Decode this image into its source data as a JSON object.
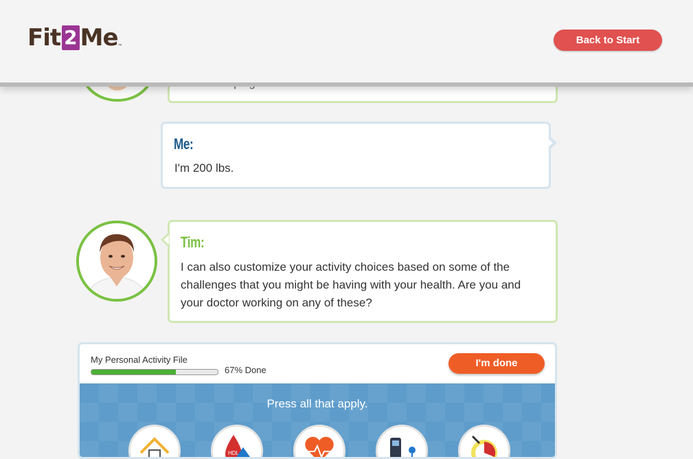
{
  "header": {
    "logo": {
      "part1": "Fit",
      "part2": "2",
      "part3": "Me",
      "trademark": "™"
    },
    "back_button": "Back to Start"
  },
  "conversation": {
    "previous_fragment": "...p...g...",
    "me": {
      "name": "Me:",
      "text": "I'm 200 lbs."
    },
    "tim": {
      "name": "Tim:",
      "text": "I can also customize your activity choices based on some of the challenges that you might be having with your health. Are you and your doctor working on any of these?"
    }
  },
  "activity_panel": {
    "title": "My Personal Activity File",
    "progress_percent": 67,
    "progress_text": "67% Done",
    "done_button": "I'm done",
    "prompt": "Press all that apply.",
    "choice_icons": [
      "house-icon",
      "hdl-cholesterol-icon",
      "heart-icon",
      "blood-sugar-meter-icon",
      "pie-chart-icon"
    ],
    "choice_badge": "HDL"
  },
  "colors": {
    "brand_purple": "#9b3594",
    "brand_brown": "#4a3325",
    "back_button": "#e0514f",
    "done_button": "#ef5d27",
    "tim_green": "#7ac143",
    "me_blue": "#1d5b8c",
    "panel_blue": "#5e9ccb"
  }
}
